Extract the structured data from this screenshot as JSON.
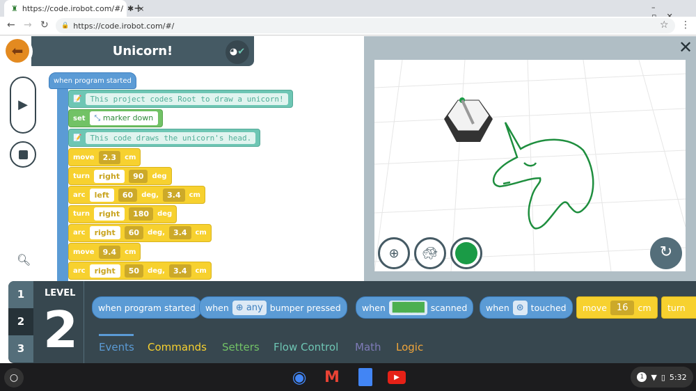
{
  "browser": {
    "tab_title": "https://code.irobot.com/#/",
    "url": "https://code.irobot.com/#/",
    "new_tab": "+",
    "tab_close": "×",
    "bluetooth": "✱"
  },
  "header": {
    "title": "Unicorn!"
  },
  "program": {
    "start": "when program started",
    "comment1": "This project codes Root to draw a unicorn!",
    "set_label": "set",
    "marker": "marker down",
    "comment2": "This code draws the unicorn's head.",
    "blocks": [
      {
        "cmd": "move",
        "val": "2.3",
        "unit": "cm"
      },
      {
        "cmd": "turn",
        "dir": "right",
        "val": "90",
        "unit": "deg"
      },
      {
        "cmd": "arc",
        "dir": "left",
        "val": "60",
        "unit": "deg,",
        "val2": "3.4",
        "unit2": "cm"
      },
      {
        "cmd": "turn",
        "dir": "right",
        "val": "180",
        "unit": "deg"
      },
      {
        "cmd": "arc",
        "dir": "right",
        "val": "60",
        "unit": "deg,",
        "val2": "3.4",
        "unit2": "cm"
      },
      {
        "cmd": "move",
        "val": "9.4",
        "unit": "cm"
      },
      {
        "cmd": "arc",
        "dir": "right",
        "val": "50",
        "unit": "deg,",
        "val2": "3.4",
        "unit2": "cm"
      }
    ]
  },
  "sim": {
    "close": "✕",
    "drawing_color": "#1e8e3e",
    "marker_color": "#1a9b46"
  },
  "palette": {
    "levels": [
      "1",
      "2",
      "3"
    ],
    "level_label": "LEVEL",
    "level_current": "2",
    "blocks": {
      "start": "when program started",
      "when": "when",
      "any": "any",
      "bumper": "bumper pressed",
      "scanned": "scanned",
      "touched": "touched",
      "move": "move",
      "move_val": "16",
      "move_unit": "cm",
      "turn": "turn"
    },
    "categories": [
      {
        "label": "Events",
        "color": "#5b9bd5"
      },
      {
        "label": "Commands",
        "color": "#f7d12f"
      },
      {
        "label": "Setters",
        "color": "#72c266"
      },
      {
        "label": "Flow Control",
        "color": "#6ec6b4"
      },
      {
        "label": "Math",
        "color": "#7e7bb8"
      },
      {
        "label": "Logic",
        "color": "#f0a53a"
      }
    ]
  },
  "taskbar": {
    "notifications": "1",
    "time": "5:32"
  }
}
